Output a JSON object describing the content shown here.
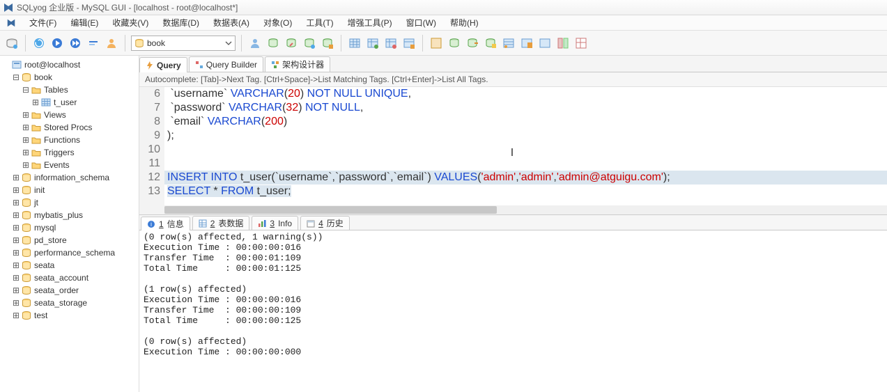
{
  "title": "SQLyog 企业版 - MySQL GUI - [localhost - root@localhost*]",
  "menu": [
    "文件(F)",
    "编辑(E)",
    "收藏夹(V)",
    "数据库(D)",
    "数据表(A)",
    "对象(O)",
    "工具(T)",
    "增强工具(P)",
    "窗口(W)",
    "帮助(H)"
  ],
  "db_combo": "book",
  "tree": {
    "root": "root@localhost",
    "book": "book",
    "tables": "Tables",
    "t_user": "t_user",
    "views": "Views",
    "stored_procs": "Stored Procs",
    "functions": "Functions",
    "triggers": "Triggers",
    "events": "Events",
    "dbs": [
      "information_schema",
      "init",
      "jt",
      "mybatis_plus",
      "mysql",
      "pd_store",
      "performance_schema",
      "seata",
      "seata_account",
      "seata_order",
      "seata_storage",
      "test"
    ]
  },
  "tabs": {
    "query": "Query",
    "builder": "Query Builder",
    "schema": "架构设计器"
  },
  "ac_hint": "Autocomplete: [Tab]->Next Tag. [Ctrl+Space]->List Matching Tags. [Ctrl+Enter]->List All Tags.",
  "lines": [
    "6",
    "7",
    "8",
    "9",
    "10",
    "11",
    "12",
    "13"
  ],
  "code": {
    "l6_uname": "username",
    "l6_vc": "VARCHAR",
    "l6_20": "20",
    "l6_nnu": "NOT NULL UNIQUE",
    "l7_pwd": "password",
    "l7_vc": "VARCHAR",
    "l7_32": "32",
    "l7_nn": "NOT NULL",
    "l8_email": "email",
    "l8_vc": "VARCHAR",
    "l8_200": "200",
    "l9_close": ");",
    "l12_ins": "INSERT INTO",
    "l12_tbl": "t_user",
    "l12_c1": "username",
    "l12_c2": "password",
    "l12_c3": "email",
    "l12_val": "VALUES",
    "l12_s1": "'admin'",
    "l12_s2": "'admin'",
    "l12_s3": "'admin@atguigu.com'",
    "l13_sel": "SELECT",
    "l13_star": "*",
    "l13_from": "FROM",
    "l13_tbl": "t_user"
  },
  "res_tabs": {
    "t1_n": "1",
    "t1_l": "信息",
    "t2_n": "2",
    "t2_l": "表数据",
    "t3_n": "3",
    "t3_l": "Info",
    "t4_n": "4",
    "t4_l": "历史"
  },
  "result": "(0 row(s) affected, 1 warning(s))\nExecution Time : 00:00:00:016\nTransfer Time  : 00:00:01:109\nTotal Time     : 00:00:01:125\n\n(1 row(s) affected)\nExecution Time : 00:00:00:016\nTransfer Time  : 00:00:00:109\nTotal Time     : 00:00:00:125\n\n(0 row(s) affected)\nExecution Time : 00:00:00:000"
}
